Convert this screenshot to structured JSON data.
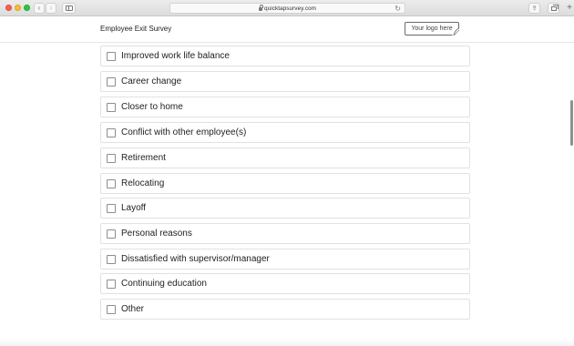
{
  "browser": {
    "url": "quicktapsurvey.com",
    "icons": {
      "back": "chevron-left-icon",
      "forward": "chevron-right-icon",
      "sidebar": "sidebar-icon",
      "lock": "lock-icon",
      "reload": "reload-icon",
      "share": "share-icon",
      "tabs": "tabs-icon",
      "new_tab": "plus-icon"
    }
  },
  "header": {
    "title": "Employee Exit Survey",
    "logo_placeholder": "Your logo here"
  },
  "options": [
    {
      "label": "Improved work life balance",
      "checked": false
    },
    {
      "label": "Career change",
      "checked": false
    },
    {
      "label": "Closer to home",
      "checked": false
    },
    {
      "label": "Conflict with other employee(s)",
      "checked": false
    },
    {
      "label": "Retirement",
      "checked": false
    },
    {
      "label": "Relocating",
      "checked": false
    },
    {
      "label": "Layoff",
      "checked": false
    },
    {
      "label": "Personal reasons",
      "checked": false
    },
    {
      "label": "Dissatisfied with supervisor/manager",
      "checked": false
    },
    {
      "label": "Continuing education",
      "checked": false
    },
    {
      "label": "Other",
      "checked": false
    }
  ]
}
